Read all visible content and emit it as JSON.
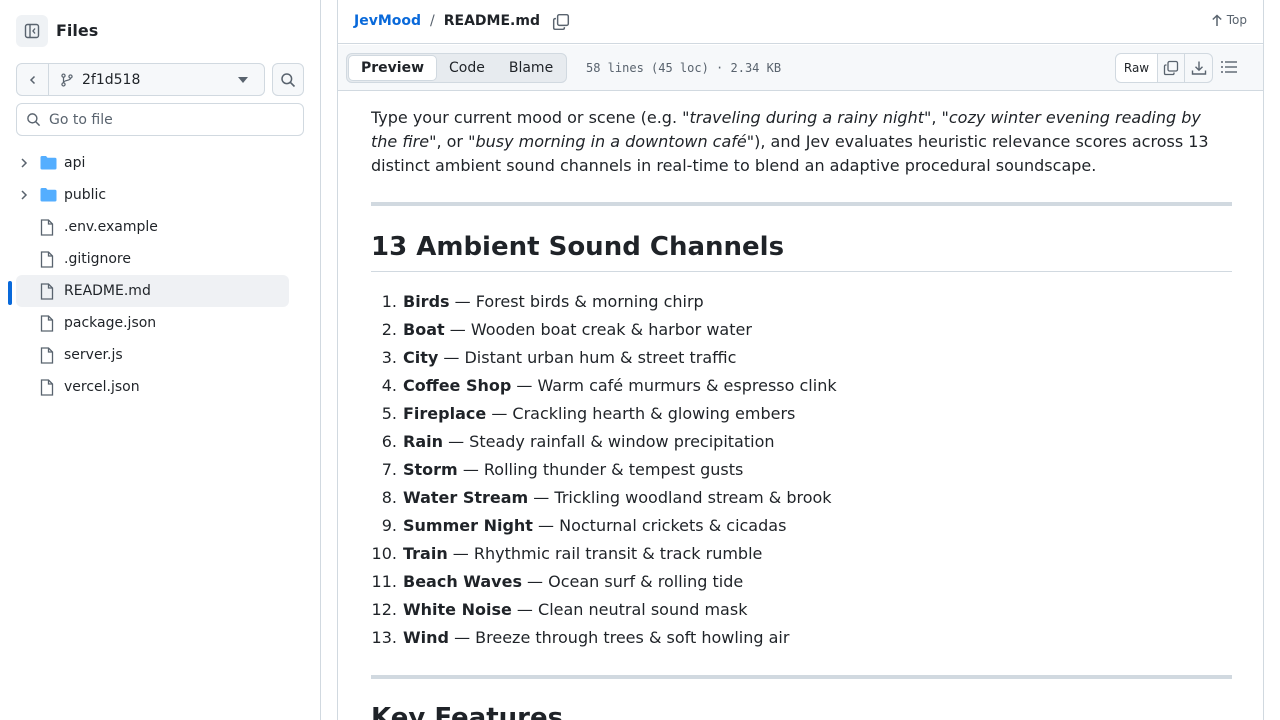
{
  "sidebar": {
    "title": "Files",
    "branch": "2f1d518",
    "goto_placeholder": "Go to file",
    "items": [
      {
        "label": "api",
        "type": "folder"
      },
      {
        "label": "public",
        "type": "folder"
      },
      {
        "label": ".env.example",
        "type": "file"
      },
      {
        "label": ".gitignore",
        "type": "file"
      },
      {
        "label": "README.md",
        "type": "file",
        "selected": true
      },
      {
        "label": "package.json",
        "type": "file"
      },
      {
        "label": "server.js",
        "type": "file"
      },
      {
        "label": "vercel.json",
        "type": "file"
      }
    ]
  },
  "header": {
    "repo": "JevMood",
    "separator": "/",
    "file": "README.md",
    "top_label": "Top"
  },
  "toolbar": {
    "tabs": [
      "Preview",
      "Code",
      "Blame"
    ],
    "active_tab": "Preview",
    "file_info": "58 lines (45 loc) · 2.34 KB",
    "raw_label": "Raw"
  },
  "readme": {
    "intro_1": "Type your current mood or scene (e.g. ",
    "example_1": "\"traveling during a rainy night\"",
    "comma_1": ", ",
    "example_2": "\"cozy winter evening reading by the fire\"",
    "comma_2": ", or ",
    "example_3": "\"busy morning in a downtown café\"",
    "intro_2": "), and Jev evaluates heuristic relevance scores across 13 distinct ambient sound channels in real-time to blend an adaptive procedural soundscape.",
    "heading_channels": "13 Ambient Sound Channels",
    "channels": [
      {
        "num": "1.",
        "name": "Birds",
        "desc": " — Forest birds & morning chirp"
      },
      {
        "num": "2.",
        "name": "Boat",
        "desc": " — Wooden boat creak & harbor water"
      },
      {
        "num": "3.",
        "name": "City",
        "desc": " — Distant urban hum & street traffic"
      },
      {
        "num": "4.",
        "name": "Coffee Shop",
        "desc": " — Warm café murmurs & espresso clink"
      },
      {
        "num": "5.",
        "name": "Fireplace",
        "desc": " — Crackling hearth & glowing embers"
      },
      {
        "num": "6.",
        "name": "Rain",
        "desc": " — Steady rainfall & window precipitation"
      },
      {
        "num": "7.",
        "name": "Storm",
        "desc": " — Rolling thunder & tempest gusts"
      },
      {
        "num": "8.",
        "name": "Water Stream",
        "desc": " — Trickling woodland stream & brook"
      },
      {
        "num": "9.",
        "name": "Summer Night",
        "desc": " — Nocturnal crickets & cicadas"
      },
      {
        "num": "10.",
        "name": "Train",
        "desc": " — Rhythmic rail transit & track rumble"
      },
      {
        "num": "11.",
        "name": "Beach Waves",
        "desc": " — Ocean surf & rolling tide"
      },
      {
        "num": "12.",
        "name": "White Noise",
        "desc": " — Clean neutral sound mask"
      },
      {
        "num": "13.",
        "name": "Wind",
        "desc": " — Breeze through trees & soft howling air"
      }
    ],
    "heading_features": "Key Features"
  },
  "colors": {
    "accent": "#0969da",
    "folder": "#54aeff",
    "border": "#d1d9e0",
    "muted": "#59636e"
  }
}
